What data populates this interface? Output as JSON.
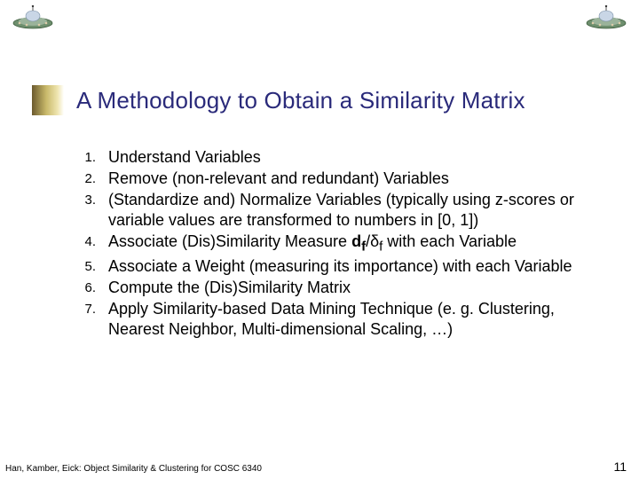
{
  "title": "A Methodology to Obtain a Similarity Matrix",
  "items": [
    "Understand Variables",
    "Remove (non-relevant and redundant) Variables",
    "(Standardize and) Normalize Variables (typically using z-scores or variable values are transformed to numbers in [0, 1])",
    "Associate (Dis)Similarity Measure d_f/δ_f with each Variable",
    "Associate a Weight (measuring its importance) with each Variable",
    "Compute the (Dis)Similarity Matrix",
    "Apply Similarity-based Data Mining Technique (e. g. Clustering, Nearest Neighbor, Multi-dimensional Scaling, …)"
  ],
  "item4_prefix": "Associate (Dis)Similarity Measure ",
  "item4_df": "d",
  "item4_df_sub": "f",
  "item4_sep": "/",
  "item4_delta": "δ",
  "item4_delta_sub": "f",
  "item4_suffix": " with each Variable",
  "footer_source": "Han, Kamber, Eick: Object Similarity & Clustering for COSC 6340",
  "page_number": "11",
  "icons": {
    "ufo": "ufo-icon"
  }
}
